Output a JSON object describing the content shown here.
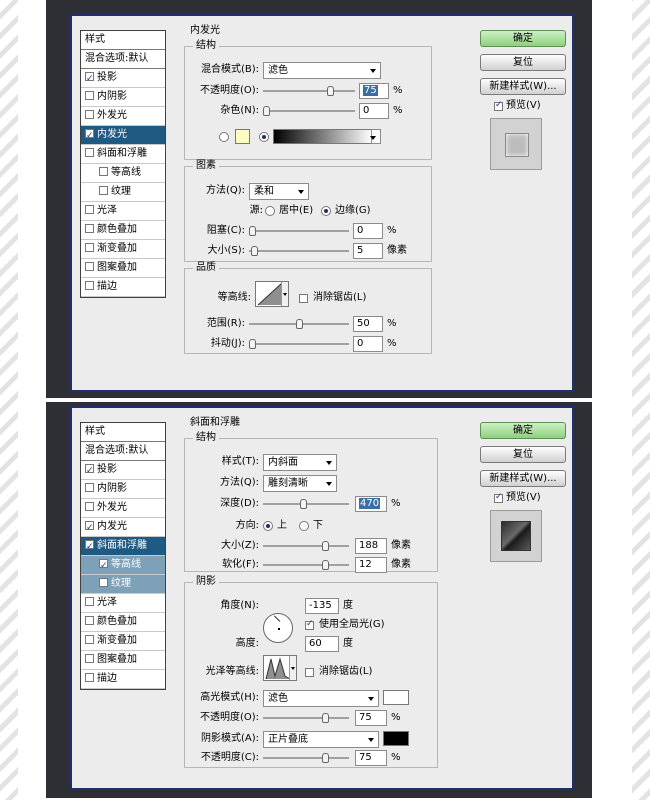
{
  "panel1": {
    "styles": [
      {
        "label": "样式",
        "kind": "header",
        "checked": null,
        "state": ""
      },
      {
        "label": "混合选项:默认",
        "kind": "header",
        "checked": null,
        "state": ""
      },
      {
        "label": "投影",
        "kind": "item",
        "checked": true,
        "state": ""
      },
      {
        "label": "内阴影",
        "kind": "item",
        "checked": false,
        "state": ""
      },
      {
        "label": "外发光",
        "kind": "item",
        "checked": false,
        "state": ""
      },
      {
        "label": "内发光",
        "kind": "item",
        "checked": true,
        "state": "sel"
      },
      {
        "label": "斜面和浮雕",
        "kind": "item",
        "checked": false,
        "state": ""
      },
      {
        "label": "等高线",
        "kind": "sub",
        "checked": false,
        "state": ""
      },
      {
        "label": "纹理",
        "kind": "sub",
        "checked": false,
        "state": ""
      },
      {
        "label": "光泽",
        "kind": "item",
        "checked": false,
        "state": ""
      },
      {
        "label": "颜色叠加",
        "kind": "item",
        "checked": false,
        "state": ""
      },
      {
        "label": "渐变叠加",
        "kind": "item",
        "checked": false,
        "state": ""
      },
      {
        "label": "图案叠加",
        "kind": "item",
        "checked": false,
        "state": ""
      },
      {
        "label": "描边",
        "kind": "item",
        "checked": false,
        "state": ""
      }
    ],
    "section_title": "内发光",
    "structure": {
      "title": "结构",
      "blend_label": "混合模式(B):",
      "blend_value": "滤色",
      "opacity_label": "不透明度(O):",
      "opacity_value": "75",
      "opacity_pct": 75,
      "noise_label": "杂色(N):",
      "noise_value": "0",
      "noise_pct": 0,
      "unit": "%",
      "color_swatch": "#fdfcc0"
    },
    "elements": {
      "title": "图素",
      "method_label": "方法(Q):",
      "method_value": "柔和",
      "source_label": "源:",
      "center_label": "居中(E)",
      "edge_label": "边缘(G)",
      "choke_label": "阻塞(C):",
      "choke_value": "0",
      "choke_pct": 0,
      "size_label": "大小(S):",
      "size_value": "5",
      "size_pct": 2,
      "size_unit": "像素",
      "unit": "%"
    },
    "quality": {
      "title": "品质",
      "contour_label": "等高线:",
      "antialias_label": "消除锯齿(L)",
      "range_label": "范围(R):",
      "range_value": "50",
      "range_pct": 50,
      "jitter_label": "抖动(J):",
      "jitter_value": "0",
      "jitter_pct": 0,
      "unit": "%"
    },
    "buttons": {
      "ok": "确定",
      "reset": "复位",
      "new_style": "新建样式(W)...",
      "preview": "预览(V)"
    }
  },
  "panel2": {
    "styles": [
      {
        "label": "样式",
        "kind": "header",
        "checked": null,
        "state": ""
      },
      {
        "label": "混合选项:默认",
        "kind": "header",
        "checked": null,
        "state": ""
      },
      {
        "label": "投影",
        "kind": "item",
        "checked": true,
        "state": ""
      },
      {
        "label": "内阴影",
        "kind": "item",
        "checked": false,
        "state": ""
      },
      {
        "label": "外发光",
        "kind": "item",
        "checked": false,
        "state": ""
      },
      {
        "label": "内发光",
        "kind": "item",
        "checked": true,
        "state": ""
      },
      {
        "label": "斜面和浮雕",
        "kind": "item",
        "checked": true,
        "state": "sel"
      },
      {
        "label": "等高线",
        "kind": "sub",
        "checked": true,
        "state": "subsel"
      },
      {
        "label": "纹理",
        "kind": "sub",
        "checked": false,
        "state": "subsel"
      },
      {
        "label": "光泽",
        "kind": "item",
        "checked": false,
        "state": ""
      },
      {
        "label": "颜色叠加",
        "kind": "item",
        "checked": false,
        "state": ""
      },
      {
        "label": "渐变叠加",
        "kind": "item",
        "checked": false,
        "state": ""
      },
      {
        "label": "图案叠加",
        "kind": "item",
        "checked": false,
        "state": ""
      },
      {
        "label": "描边",
        "kind": "item",
        "checked": false,
        "state": ""
      }
    ],
    "section_title": "斜面和浮雕",
    "structure": {
      "title": "结构",
      "style_label": "样式(T):",
      "style_value": "内斜面",
      "technique_label": "方法(Q):",
      "technique_value": "雕刻清晰",
      "depth_label": "深度(D):",
      "depth_value": "470",
      "depth_pct": 47,
      "direction_label": "方向:",
      "up_label": "上",
      "down_label": "下",
      "size_label": "大小(Z):",
      "size_value": "188",
      "size_pct": 75,
      "soften_label": "软化(F):",
      "soften_value": "12",
      "soften_pct": 75,
      "px_unit": "像素",
      "pct_unit": "%"
    },
    "shading": {
      "title": "阴影",
      "angle_label": "角度(N):",
      "angle_value": "-135",
      "angle_unit": "度",
      "global_light_label": "使用全局光(G)",
      "altitude_label": "高度:",
      "altitude_value": "60",
      "altitude_unit": "度",
      "gloss_label": "光泽等高线:",
      "antialias_label": "消除锯齿(L)",
      "highlight_label": "高光模式(H):",
      "highlight_value": "滤色",
      "highlight_color": "#ffffff",
      "hl_opacity_label": "不透明度(O):",
      "hl_opacity_value": "75",
      "hl_opacity_pct": 75,
      "shadow_label": "阴影模式(A):",
      "shadow_value": "正片叠底",
      "shadow_color": "#000000",
      "sh_opacity_label": "不透明度(C):",
      "sh_opacity_value": "75",
      "sh_opacity_pct": 75,
      "pct_unit": "%"
    },
    "buttons": {
      "ok": "确定",
      "reset": "复位",
      "new_style": "新建样式(W)...",
      "preview": "预览(V)"
    }
  }
}
